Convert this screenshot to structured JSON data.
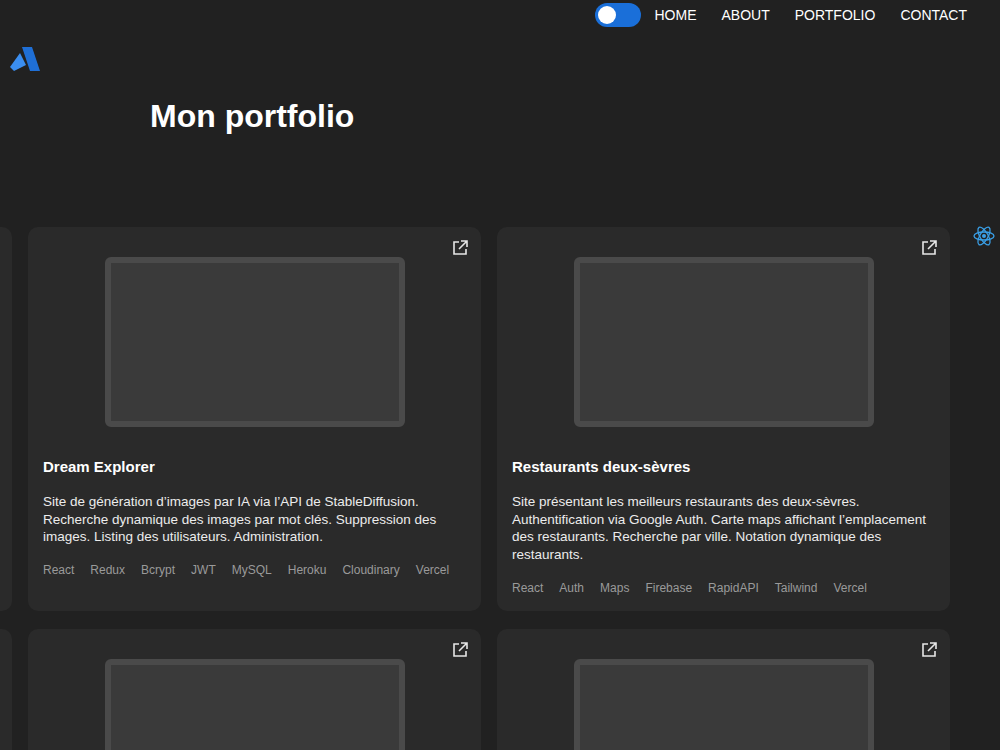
{
  "nav": {
    "theme_toggle": {
      "on": true
    },
    "links": [
      {
        "label": "HOME"
      },
      {
        "label": "ABOUT"
      },
      {
        "label": "PORTFOLIO"
      },
      {
        "label": "CONTACT"
      }
    ]
  },
  "page": {
    "title": "Mon portfolio"
  },
  "projects": [
    {
      "kind": "full",
      "title": "Dream Explorer",
      "description": "Site de génération d’images par IA via l’API de StableDiffusion. Recherche dynamique des images par mot clés. Suppression des images. Listing des utilisateurs. Administration.",
      "tags": [
        "React",
        "Redux",
        "Bcrypt",
        "JWT",
        "MySQL",
        "Heroku",
        "Cloudinary",
        "Vercel"
      ]
    },
    {
      "kind": "full",
      "title": "Restaurants deux-sèvres",
      "description": "Site présentant les meilleurs restaurants des deux-sèvres. Authentification via Google Auth. Carte maps affichant l’emplacement des restaurants. Recherche par ville. Notation dynamique des restaurants.",
      "tags": [
        "React",
        "Auth",
        "Maps",
        "Firebase",
        "RapidAPI",
        "Tailwind",
        "Vercel"
      ]
    },
    {
      "kind": "image-only",
      "title": "",
      "description": "",
      "tags": []
    },
    {
      "kind": "image-only",
      "title": "",
      "description": "",
      "tags": []
    }
  ]
}
